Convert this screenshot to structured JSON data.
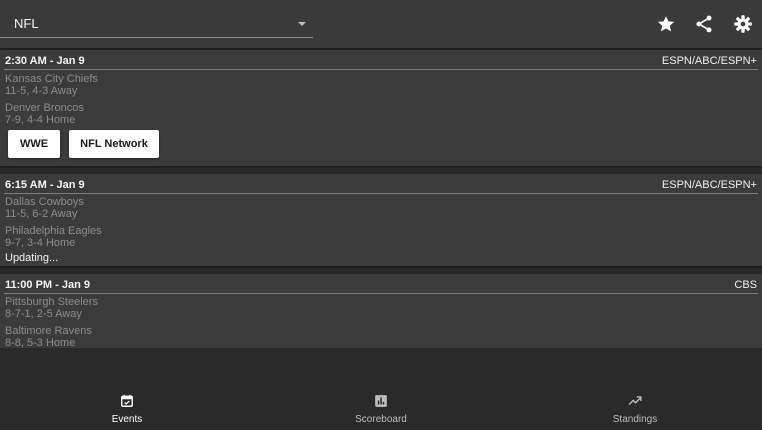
{
  "header": {
    "league": "NFL",
    "icons": {
      "favorite": "star-icon",
      "share": "share-icon",
      "settings": "gear-icon"
    }
  },
  "events": [
    {
      "time": "2:30 AM - Jan 9",
      "network": "ESPN/ABC/ESPN+",
      "away": {
        "name": "Kansas City Chiefs",
        "record": "11-5, 4-3 Away"
      },
      "home": {
        "name": "Denver Broncos",
        "record": "7-9, 4-4 Home"
      },
      "buttons": [
        "WWE",
        "NFL Network"
      ]
    },
    {
      "time": "6:15 AM - Jan 9",
      "network": "ESPN/ABC/ESPN+",
      "away": {
        "name": "Dallas Cowboys",
        "record": "11-5, 6-2 Away"
      },
      "home": {
        "name": "Philadelphia Eagles",
        "record": "9-7, 3-4 Home"
      },
      "status": "Updating..."
    },
    {
      "time": "11:00 PM - Jan 9",
      "network": "CBS",
      "away": {
        "name": "Pittsburgh Steelers",
        "record": "8-7-1, 2-5 Away"
      },
      "home": {
        "name": "Baltimore Ravens",
        "record": "8-8, 5-3 Home"
      }
    }
  ],
  "nav": {
    "items": [
      {
        "label": "Events",
        "icon": "calendar-check-icon",
        "active": true
      },
      {
        "label": "Scoreboard",
        "icon": "bar-chart-icon",
        "active": false
      },
      {
        "label": "Standings",
        "icon": "trending-up-icon",
        "active": false
      }
    ]
  },
  "colors": {
    "active": "#ffffff",
    "inactive": "#bdbdbd",
    "card": "#3b3b3b",
    "background": "#2a2a2a"
  }
}
